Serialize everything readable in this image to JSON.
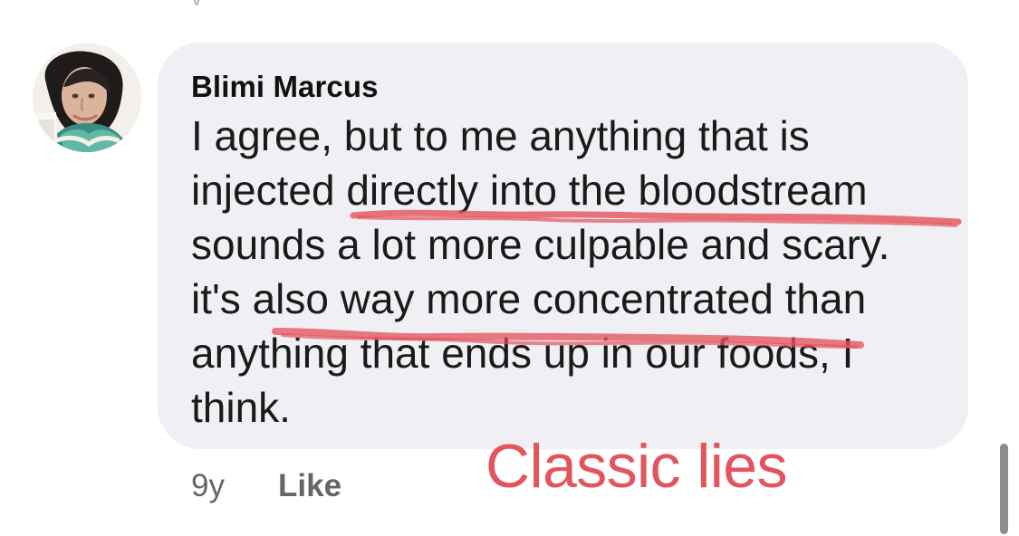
{
  "top_fragment": "y",
  "comment": {
    "author": "Blimi Marcus",
    "lines": [
      "I agree, but to me anything that is",
      "injected directly into the bloodstream",
      "sounds a lot more culpable and scary.",
      "it's also way more concentrated than",
      "anything that ends up in our foods, I",
      "think."
    ]
  },
  "annotation": {
    "text": "Classic lies",
    "color": "#e3555d"
  },
  "footer": {
    "age": "9y",
    "like": "Like"
  },
  "colors": {
    "bubble": "#f0f0f4",
    "text": "#1a1a1a",
    "meta": "#666666",
    "scribble": "#e3555d"
  },
  "icons": {
    "avatar": "profile-photo"
  }
}
